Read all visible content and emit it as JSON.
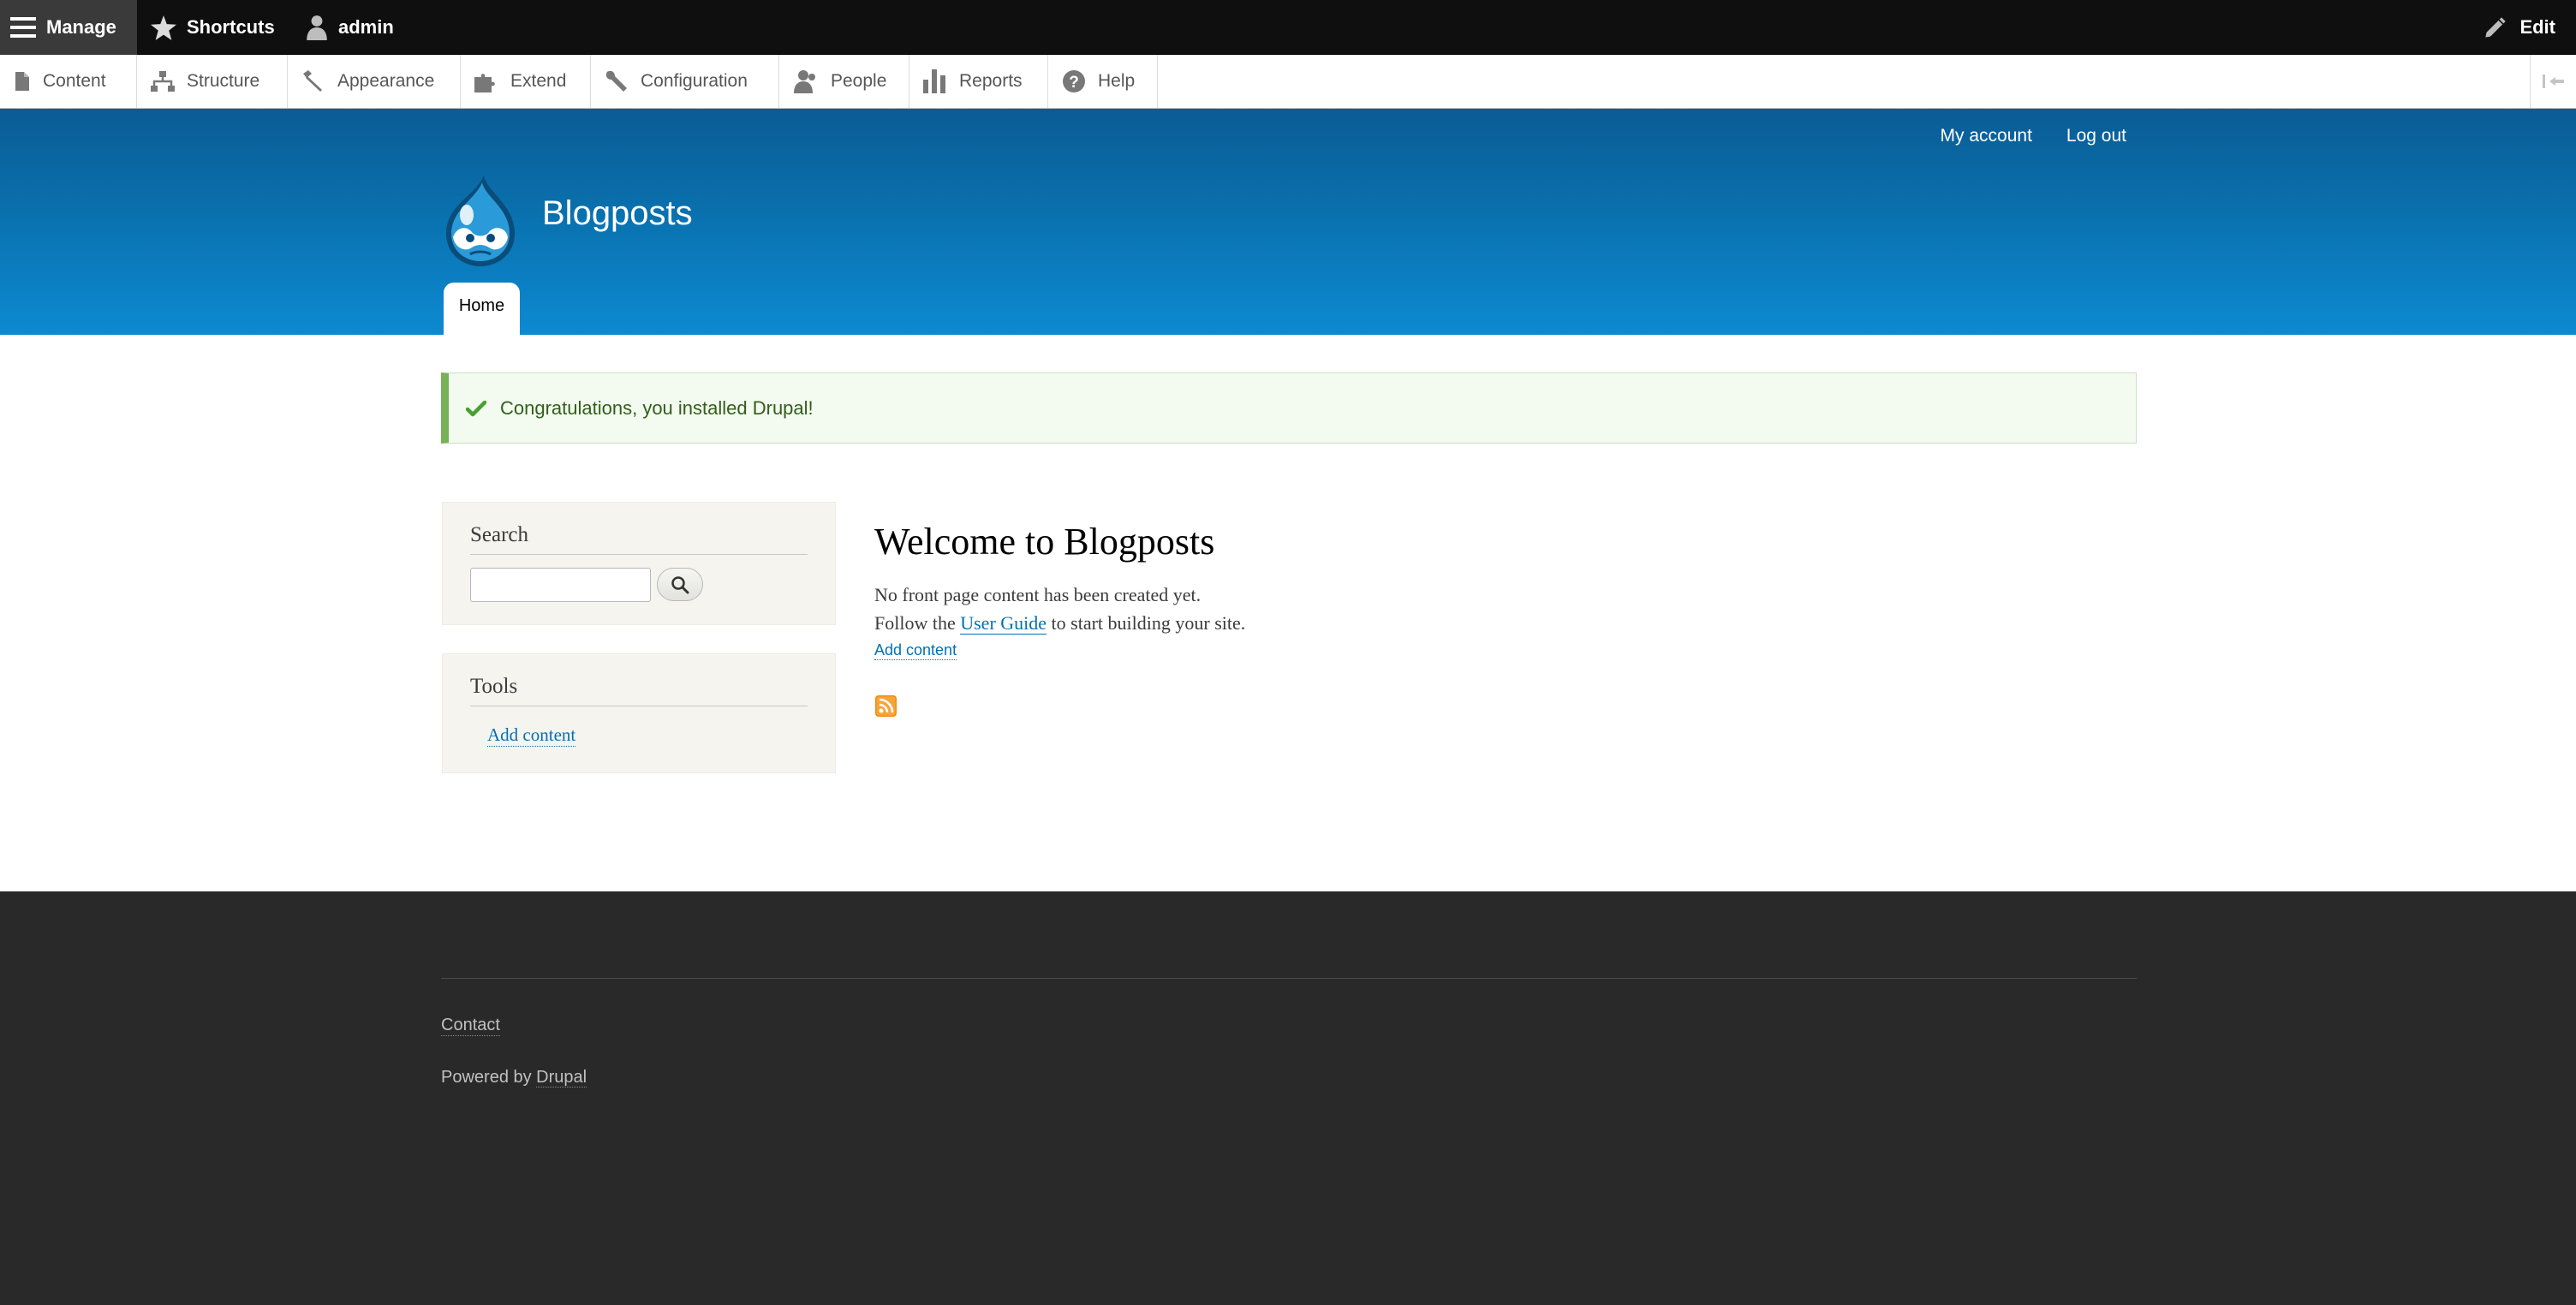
{
  "toolbar": {
    "manage_label": "Manage",
    "shortcuts_label": "Shortcuts",
    "user_label": "admin",
    "edit_label": "Edit"
  },
  "tray": {
    "items": [
      {
        "label": "Content",
        "icon": "file-icon"
      },
      {
        "label": "Structure",
        "icon": "sitemap-icon"
      },
      {
        "label": "Appearance",
        "icon": "brush-icon"
      },
      {
        "label": "Extend",
        "icon": "puzzle-icon"
      },
      {
        "label": "Configuration",
        "icon": "wrench-icon"
      },
      {
        "label": "People",
        "icon": "people-icon"
      },
      {
        "label": "Reports",
        "icon": "bar-chart-icon"
      },
      {
        "label": "Help",
        "icon": "help-icon"
      }
    ]
  },
  "header": {
    "secondary_links": [
      "My account",
      "Log out"
    ],
    "site_name": "Blogposts",
    "tabs": [
      "Home"
    ]
  },
  "status": {
    "message": "Congratulations, you installed Drupal!"
  },
  "sidebar": {
    "search_title": "Search",
    "search_value": "",
    "tools_title": "Tools",
    "tools_link": "Add content"
  },
  "main": {
    "title": "Welcome to Blogposts",
    "line1": "No front page content has been created yet.",
    "line2_before": "Follow the ",
    "line2_link": "User Guide",
    "line2_after": " to start building your site.",
    "add_content": "Add content"
  },
  "footer": {
    "contact": "Contact",
    "powered_prefix": "Powered by ",
    "powered_link": "Drupal"
  },
  "colors": {
    "toolbar_bg": "#0f0f0f",
    "header_top": "#0a5c95",
    "header_bottom": "#0c8ad2",
    "status_border": "#77b259",
    "link": "#0071b3",
    "footer_bg": "#292929",
    "feed": "#f28c12"
  }
}
